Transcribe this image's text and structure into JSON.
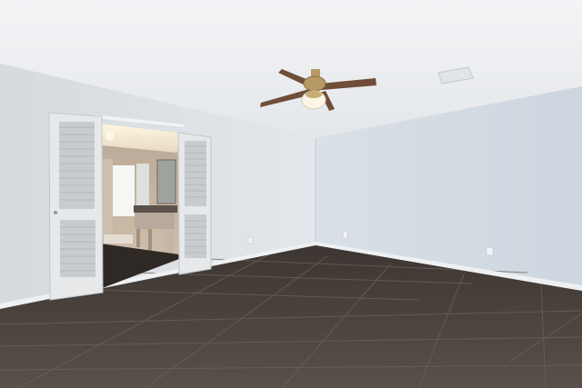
{
  "scene": {
    "kind": "empty-room-photo",
    "features": [
      "ceiling-fan",
      "bifold-louvered-doors",
      "bathroom-doorway",
      "vanity",
      "tile-floor",
      "wall-outlets",
      "air-vent"
    ]
  },
  "colors": {
    "ceiling": "#eef0f2",
    "left_wall": "#dfe3e7",
    "right_wall": "#d5dde5",
    "floor": "#4a423c",
    "grout": "#6a625b",
    "baseboard": "#f0f2f4",
    "door": "#e8eaec",
    "fan_brass": "#b79a63",
    "fan_blade": "#6e4e38",
    "bathroom_wall": "#c9b6a1",
    "window_light": "#f6f7f5"
  }
}
